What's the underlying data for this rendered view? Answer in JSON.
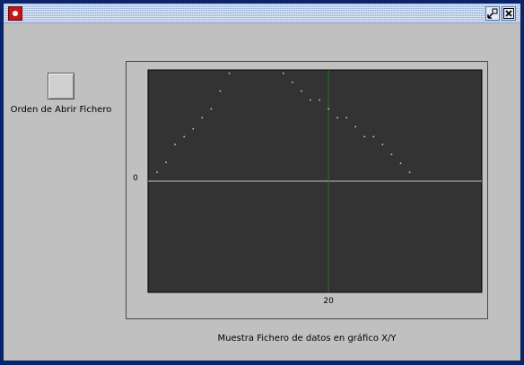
{
  "window": {
    "title": "",
    "icons": {
      "app": "app-icon",
      "minmax": "restore-icon",
      "close": "close-icon"
    }
  },
  "controls": {
    "open_button_label": "",
    "open_label": "Orden de Abrir Fichero"
  },
  "caption": "Muestra Fichero de datos en gráfico X/Y",
  "colors": {
    "plot_background": "#333333",
    "points": "#d8d8d8",
    "x_axis": "#c0c0c0",
    "y_axis": "#1f7a1f",
    "window_frame": "#0a246a",
    "panel": "#c0c0c0"
  },
  "chart_data": {
    "type": "scatter",
    "title": "",
    "xlabel": "",
    "ylabel": "",
    "xlim": [
      0,
      37
    ],
    "ylim": [
      -1.0,
      1.0
    ],
    "xticks": [
      {
        "value": 20,
        "label": "20"
      }
    ],
    "yticks": [
      {
        "value": 0,
        "label": "0"
      }
    ],
    "grid": false,
    "legend": "none",
    "series": [
      {
        "x": [
          1,
          2,
          3,
          4,
          5,
          6,
          7,
          8,
          9,
          15,
          16,
          17,
          18,
          19,
          20,
          21,
          22,
          23,
          24,
          25,
          26,
          27,
          28,
          29
        ],
        "y": [
          0.08,
          0.17,
          0.33,
          0.4,
          0.47,
          0.57,
          0.65,
          0.81,
          0.97,
          0.97,
          0.89,
          0.81,
          0.73,
          0.73,
          0.65,
          0.57,
          0.57,
          0.49,
          0.4,
          0.4,
          0.33,
          0.24,
          0.16,
          0.08
        ]
      }
    ]
  }
}
